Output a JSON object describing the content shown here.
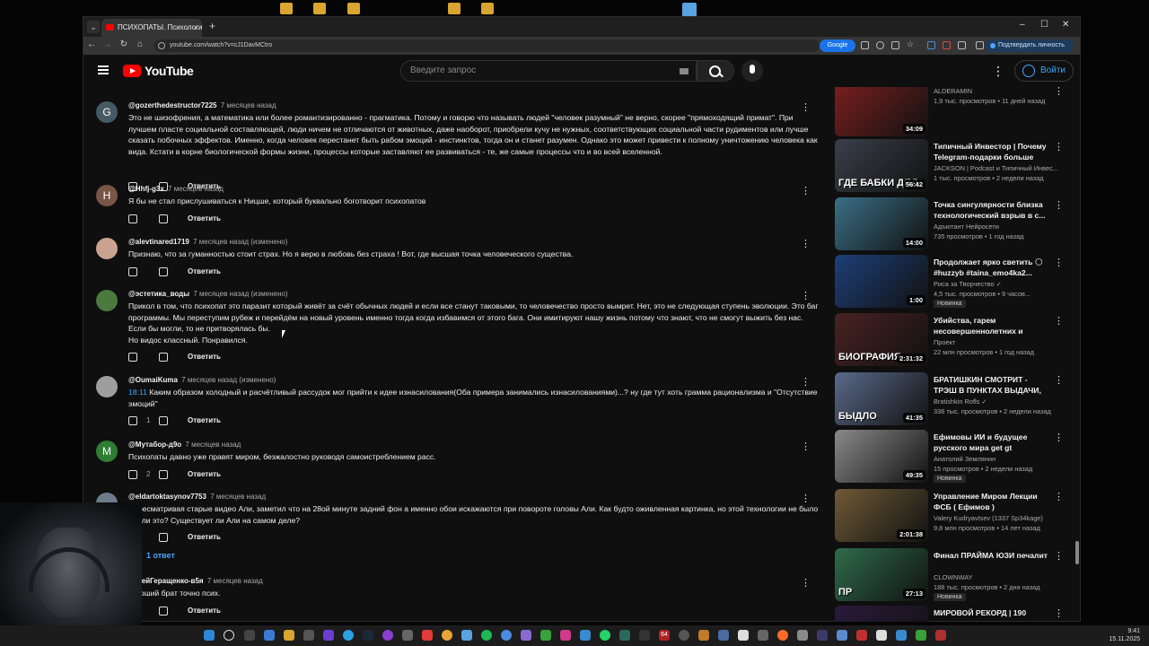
{
  "browser": {
    "tab_title": "ПСИХОПАТЫ. Психология усп",
    "new_tab": "+",
    "url": "youtube.com/watch?v=cJ1DavMCtro",
    "google_chip": "Google",
    "verify_chip": "Подтвердить личность",
    "window_controls": {
      "minimize": "–",
      "maximize": "☐",
      "close": "✕"
    },
    "nav": {
      "back": "←",
      "forward": "→",
      "reload": "↻",
      "home": "⌂"
    }
  },
  "youtube": {
    "logo": "YouTube",
    "search_placeholder": "Введите запрос",
    "login": "Войти"
  },
  "comments": [
    {
      "author": "@gozerthedestructor7225",
      "time": "7 месяцев назад",
      "avatar_letter": "G",
      "avatar_color": "#455a64",
      "text": "Это не шизофрения, а математика или более романтизированно - прагматика. Потому и говорю что называть людей \"человек разумный\" не верно, скорее \"прямоходящий примат\". При лучшем пласте социальной составляющей, люди ничем не отличаются от животных, даже наоборот, приобрели кучу не нужных, соответствующих социальной части рудиментов или лучше сказать побочных эффектов. Именно, когда человек перестанет быть рабом эмоций - инстинктов, тогда он и станет разумен. Однако это может привести к полному уничтожению человека как вида. Кстати в корне биологической формы жизни, процессы которые заставляют ее развиваться - те, же самые процессы что и во всей вселенной.",
      "likes": "",
      "reply": "Ответить",
      "timecode": ""
    },
    {
      "author": "@Hhfj-g3x",
      "time": "7 месяцев назад",
      "avatar_letter": "H",
      "avatar_color": "#795548",
      "text": "Я бы не стал прислушиваться к Ницше, который буквально боготворит психопатов",
      "likes": "",
      "reply": "Ответить",
      "timecode": ""
    },
    {
      "author": "@alevtinared1719",
      "time": "7 месяцев назад (изменено)",
      "avatar_letter": "",
      "avatar_color": "#c9a38f",
      "text": "Признаю, что за гуманностью стоит страх. Но я верю в любовь без страха ! Вот, где высшая точка человеческого существа.",
      "likes": "",
      "reply": "Ответить",
      "timecode": ""
    },
    {
      "author": "@эстетика_воды",
      "time": "7 месяцев назад (изменено)",
      "avatar_letter": "",
      "avatar_color": "#4b7a3f",
      "text": "Прикол в том, что психопат это паразит который живёт за счёт обычных людей и если все станут таковыми, то человечество просто вымрет. Нет, это не следующая ступень эволюции. Это баг программы. Мы переступим рубеж и перейдём на новый уровень именно тогда когда избавимся от этого бага. Они имитируют нашу жизнь потому что знают, что не смогут выжить без нас. Если бы могли, то не притворялась бы.\nНо видос классный. Понравился.",
      "likes": "",
      "reply": "Ответить",
      "timecode": ""
    },
    {
      "author": "@OumaiKuma",
      "time": "7 месяцев назад (изменено)",
      "avatar_letter": "",
      "avatar_color": "#9e9e9e",
      "text": " Каким образом холодный и расчётливый рассудок мог прийти к идее изнасилования(Оба примера занимались изнасилованиями)...? ну где тут хоть грамма рационализма и \"Отсутствие эмоций\"",
      "likes": "1",
      "reply": "Ответить",
      "timecode": "18:11"
    },
    {
      "author": "@Мутабор-д9о",
      "time": "7 месяцев назад",
      "avatar_letter": "M",
      "avatar_color": "#2e7d32",
      "text": "Психопаты давно уже правят миром, безжалостно руководя самоистреблением расс.",
      "likes": "2",
      "reply": "Ответить",
      "timecode": ""
    },
    {
      "author": "@eldartoktasynov7753",
      "time": "7 месяцев назад",
      "avatar_letter": "",
      "avatar_color": "#6d7b8a",
      "text": "Пересматривая старые видео Али, заметил что на 28ой минуте задний фон а именно обои искажаются при повороте головы Али. Как будто оживленная картинка, но этой технологии не было так ли это? Существует ли Али на самом деле?",
      "likes": "",
      "reply": "Ответить",
      "timecode": "",
      "replies": "1 ответ"
    },
    {
      "author": "ндрейГеращенко-в5я",
      "time": "7 месяцев назад",
      "avatar_letter": "",
      "avatar_color": "#333",
      "text": "старший брат точно псих.",
      "likes": "",
      "reply": "Ответить",
      "timecode": ""
    }
  ],
  "recommendations": [
    {
      "title": "",
      "channel": "ALDERAMIN",
      "meta": "1,9 тыс. просмотров • 11 дней назад",
      "duration": "34:09",
      "thumb_text": "",
      "thumb_color": "#7a1f1f",
      "badge": ""
    },
    {
      "title": "Типичный Инвестор | Почему Telegram-подарки больше не...",
      "channel": "JACKSON | Podcast и Типичный Инвес...",
      "meta": "1 тыс. просмотров • 2 недели назад",
      "duration": "56:42",
      "thumb_text": "ГДЕ БАБКИ ДЯД",
      "thumb_color": "#3a3f4a",
      "badge": ""
    },
    {
      "title": "Точка сингулярности близка технологический взрыв в с...",
      "channel": "Адъютант Нейросети",
      "meta": "735 просмотров • 1 год назад",
      "duration": "14:00",
      "thumb_text": "",
      "thumb_color": "#3b6f86",
      "badge": ""
    },
    {
      "title": "Продолжает ярко светить 🌕 #huzzyb #taina_emo4ka2...",
      "channel": "Риса за Творчество ✓",
      "meta": "4,5 тыс. просмотров • 9 часов...",
      "duration": "1:00",
      "thumb_text": "",
      "thumb_color": "#1e3f78",
      "badge": "Новинка"
    },
    {
      "title": "Убийства, гарем несовершеннолетних и тайн...",
      "channel": "Проект",
      "meta": "22 млн просмотров • 1 год назад",
      "duration": "2:31:32",
      "thumb_text": "БИОГРАФИЯ",
      "thumb_color": "#4a2222",
      "badge": ""
    },
    {
      "title": "БРАТИШКИН СМОТРИТ - ТРЭШ В ПУНКТАХ ВЫДАЧИ, ...",
      "channel": "Bratishkin Rofls ✓",
      "meta": "336 тыс. просмотров • 2 недели назад",
      "duration": "41:35",
      "thumb_text": "БЫДЛО",
      "thumb_color": "#5a6a8a",
      "badge": ""
    },
    {
      "title": "Ефимовы ИИ и будущее русского мира get gt",
      "channel": "Анатолий Землянин",
      "meta": "15 просмотров • 2 недели назад",
      "duration": "49:35",
      "thumb_text": "",
      "thumb_color": "#8a8a8a",
      "badge": "Новинка"
    },
    {
      "title": "Управление Миром Лекции ФСБ ( Ефимов )",
      "channel": "Valery Kudryavtsev (1337 Sp34kage)",
      "meta": "9,8 млн просмотров • 14 лет назад",
      "duration": "2:01:38",
      "thumb_text": "",
      "thumb_color": "#6f5a36",
      "badge": ""
    },
    {
      "title": "Финал ПРАЙМА ЮЗИ печалит",
      "channel": "CLOWNWAY",
      "meta": "188 тыс. просмотров • 2 дня назад",
      "duration": "27:13",
      "thumb_text": "ПР",
      "thumb_color": "#2f6b4a",
      "badge": "Новинка"
    },
    {
      "title": "МИРОВОЙ РЕКОРД | 190",
      "channel": "",
      "meta": "",
      "duration": "",
      "thumb_text": "ЧЕЛЛЕНДЖ",
      "thumb_color": "#2a1a3a",
      "badge": ""
    }
  ],
  "taskbar": {
    "time": "9:41",
    "date": "15.11.2025",
    "badge_64": "64"
  }
}
